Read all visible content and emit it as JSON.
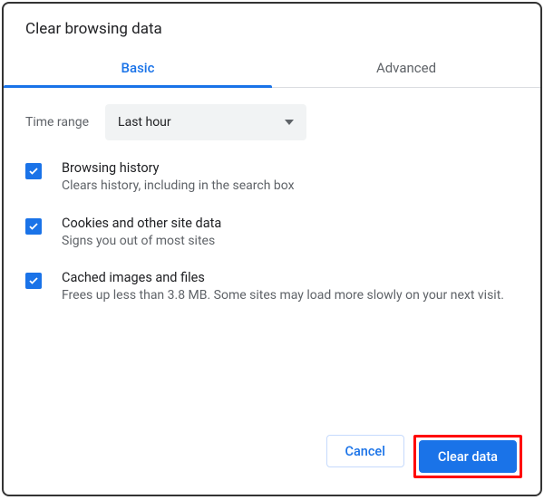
{
  "dialog": {
    "title": "Clear browsing data"
  },
  "tabs": {
    "basic": "Basic",
    "advanced": "Advanced"
  },
  "timerange": {
    "label": "Time range",
    "value": "Last hour"
  },
  "options": [
    {
      "title": "Browsing history",
      "desc": "Clears history, including in the search box",
      "checked": true
    },
    {
      "title": "Cookies and other site data",
      "desc": "Signs you out of most sites",
      "checked": true
    },
    {
      "title": "Cached images and files",
      "desc": "Frees up less than 3.8 MB. Some sites may load more slowly on your next visit.",
      "checked": true
    }
  ],
  "buttons": {
    "cancel": "Cancel",
    "clear": "Clear data"
  }
}
